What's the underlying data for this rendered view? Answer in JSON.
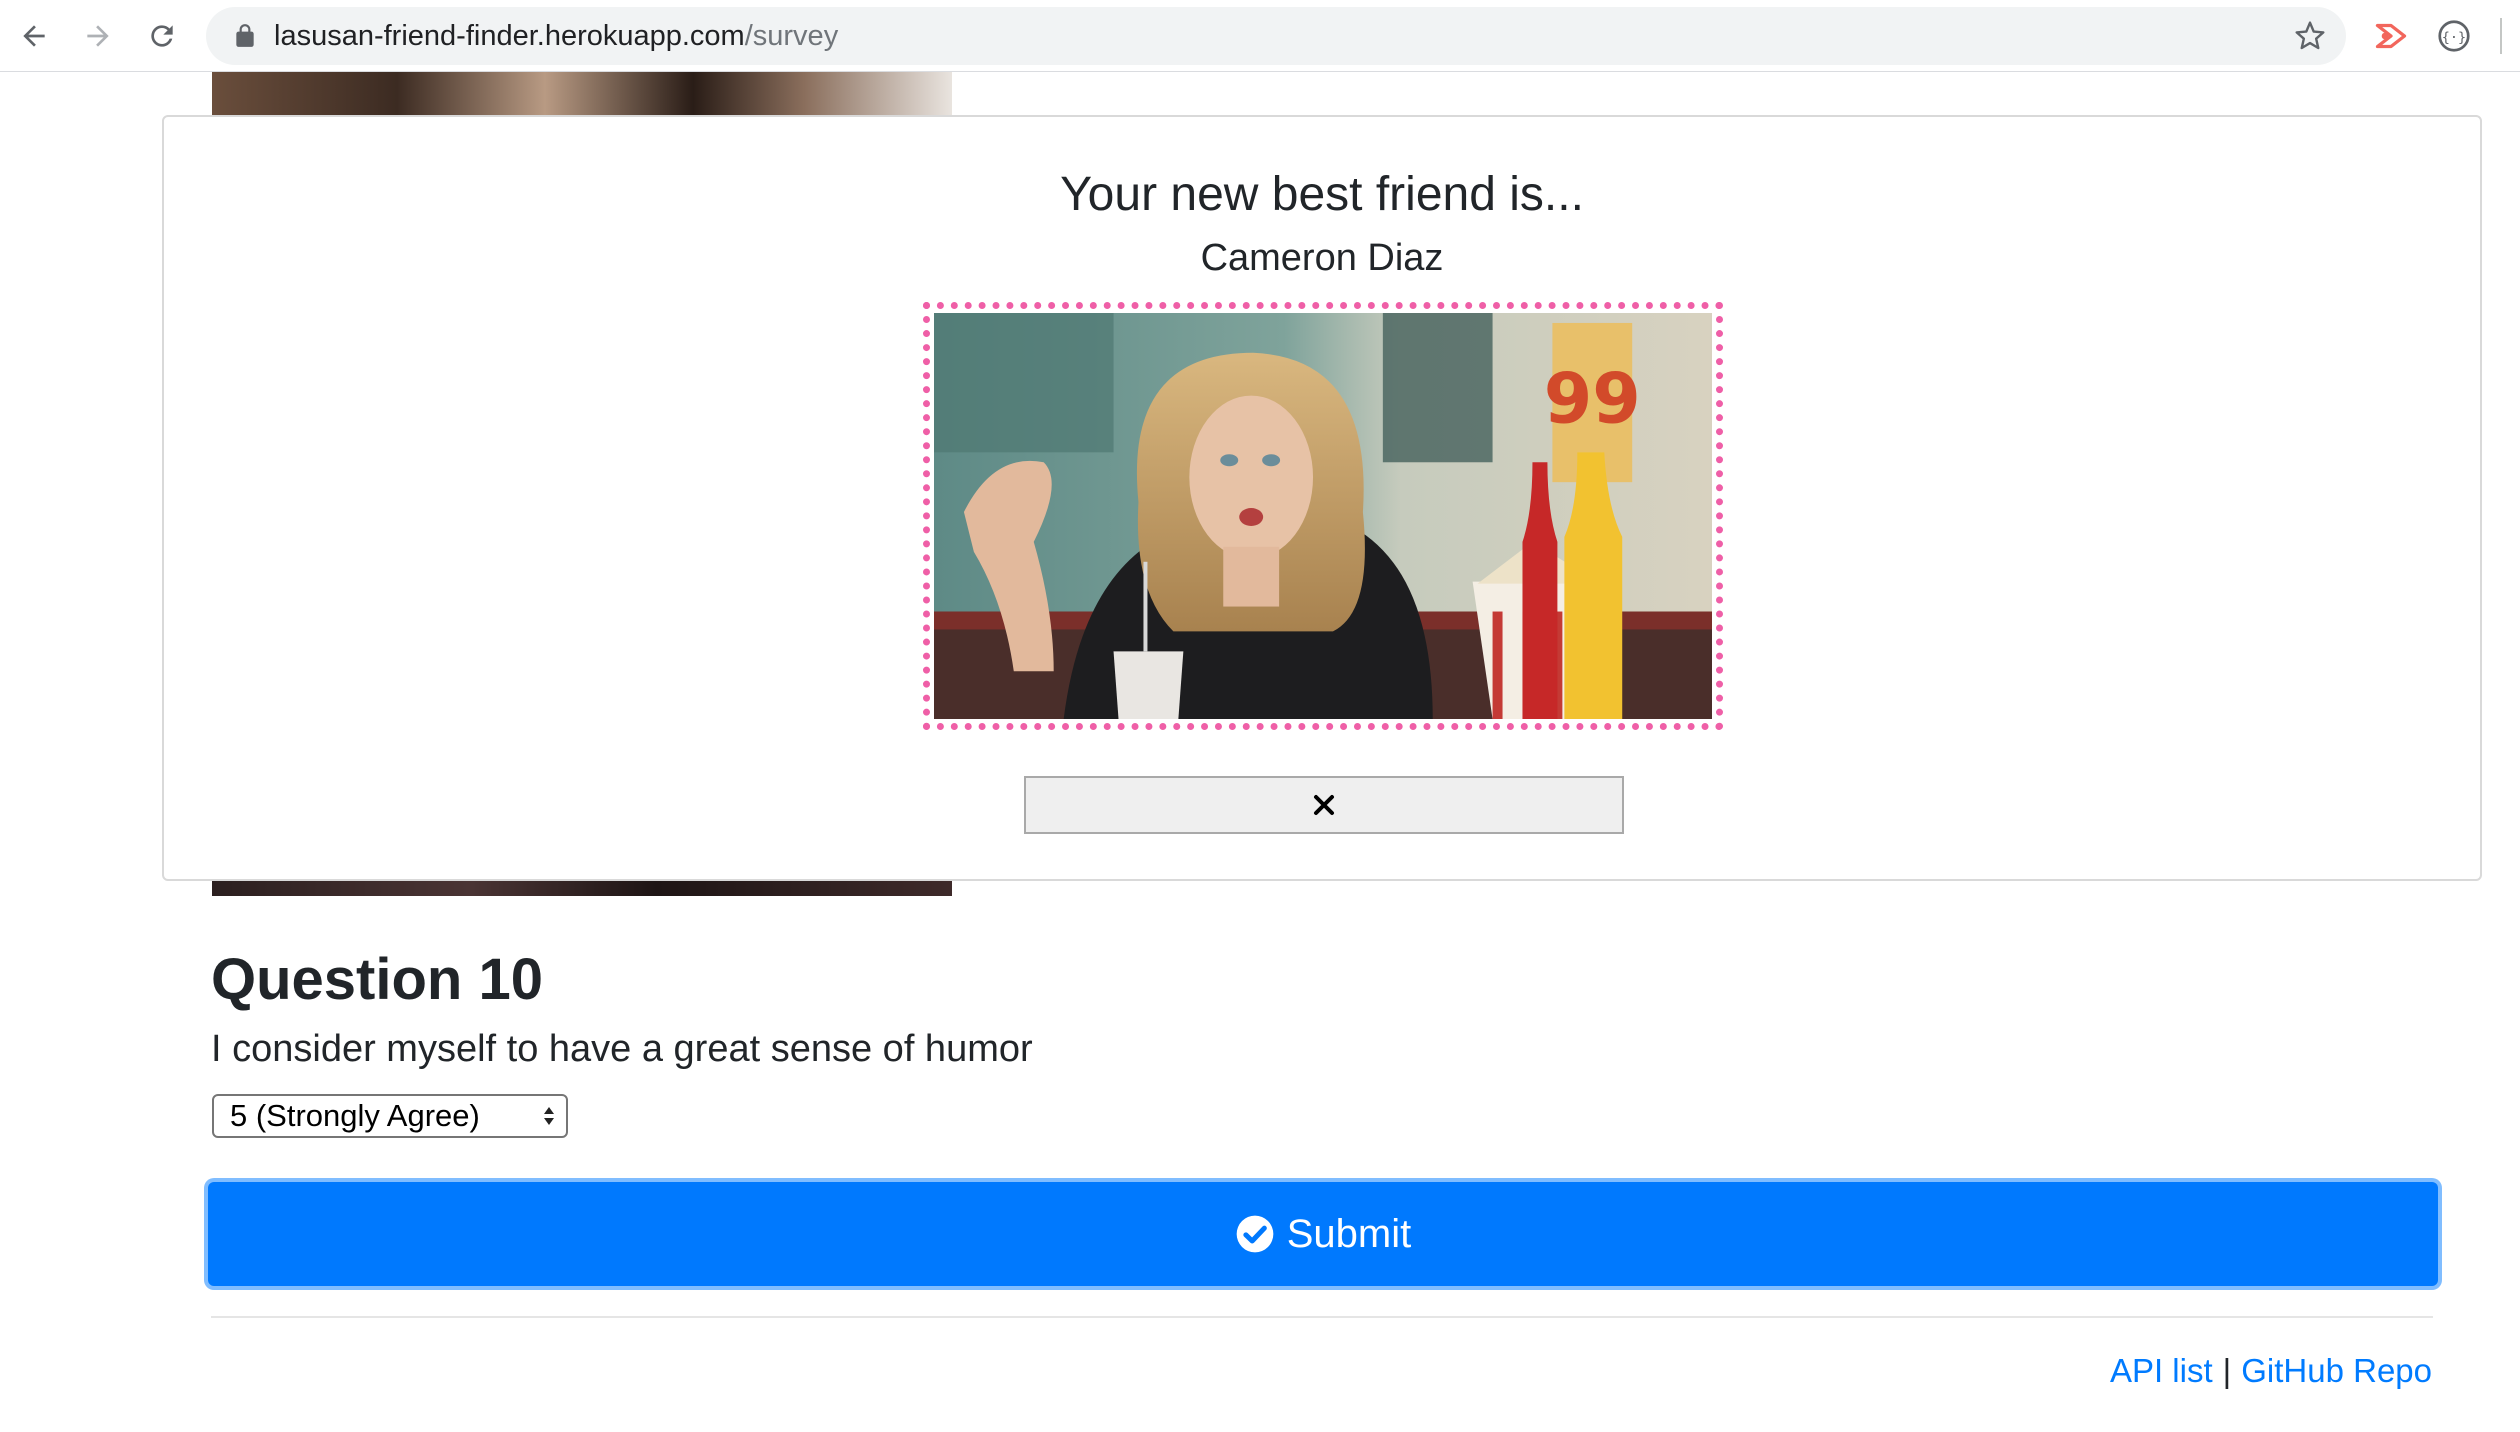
{
  "browser": {
    "url_host": "lasusan-friend-finder.herokuapp.com",
    "url_path": "/survey"
  },
  "modal": {
    "title": "Your new best friend is...",
    "match_name": "Cameron Diaz",
    "photo_frame_color": "#ef5fa7"
  },
  "question": {
    "title": "Question 10",
    "text": "I consider myself to have a great sense of humor",
    "selected_answer": "5 (Strongly Agree)"
  },
  "submit": {
    "label": "Submit",
    "color": "#0079fe"
  },
  "footer": {
    "api_link": "API list",
    "separator": "|",
    "github_link": "GitHub Repo",
    "link_color": "#007bff"
  }
}
